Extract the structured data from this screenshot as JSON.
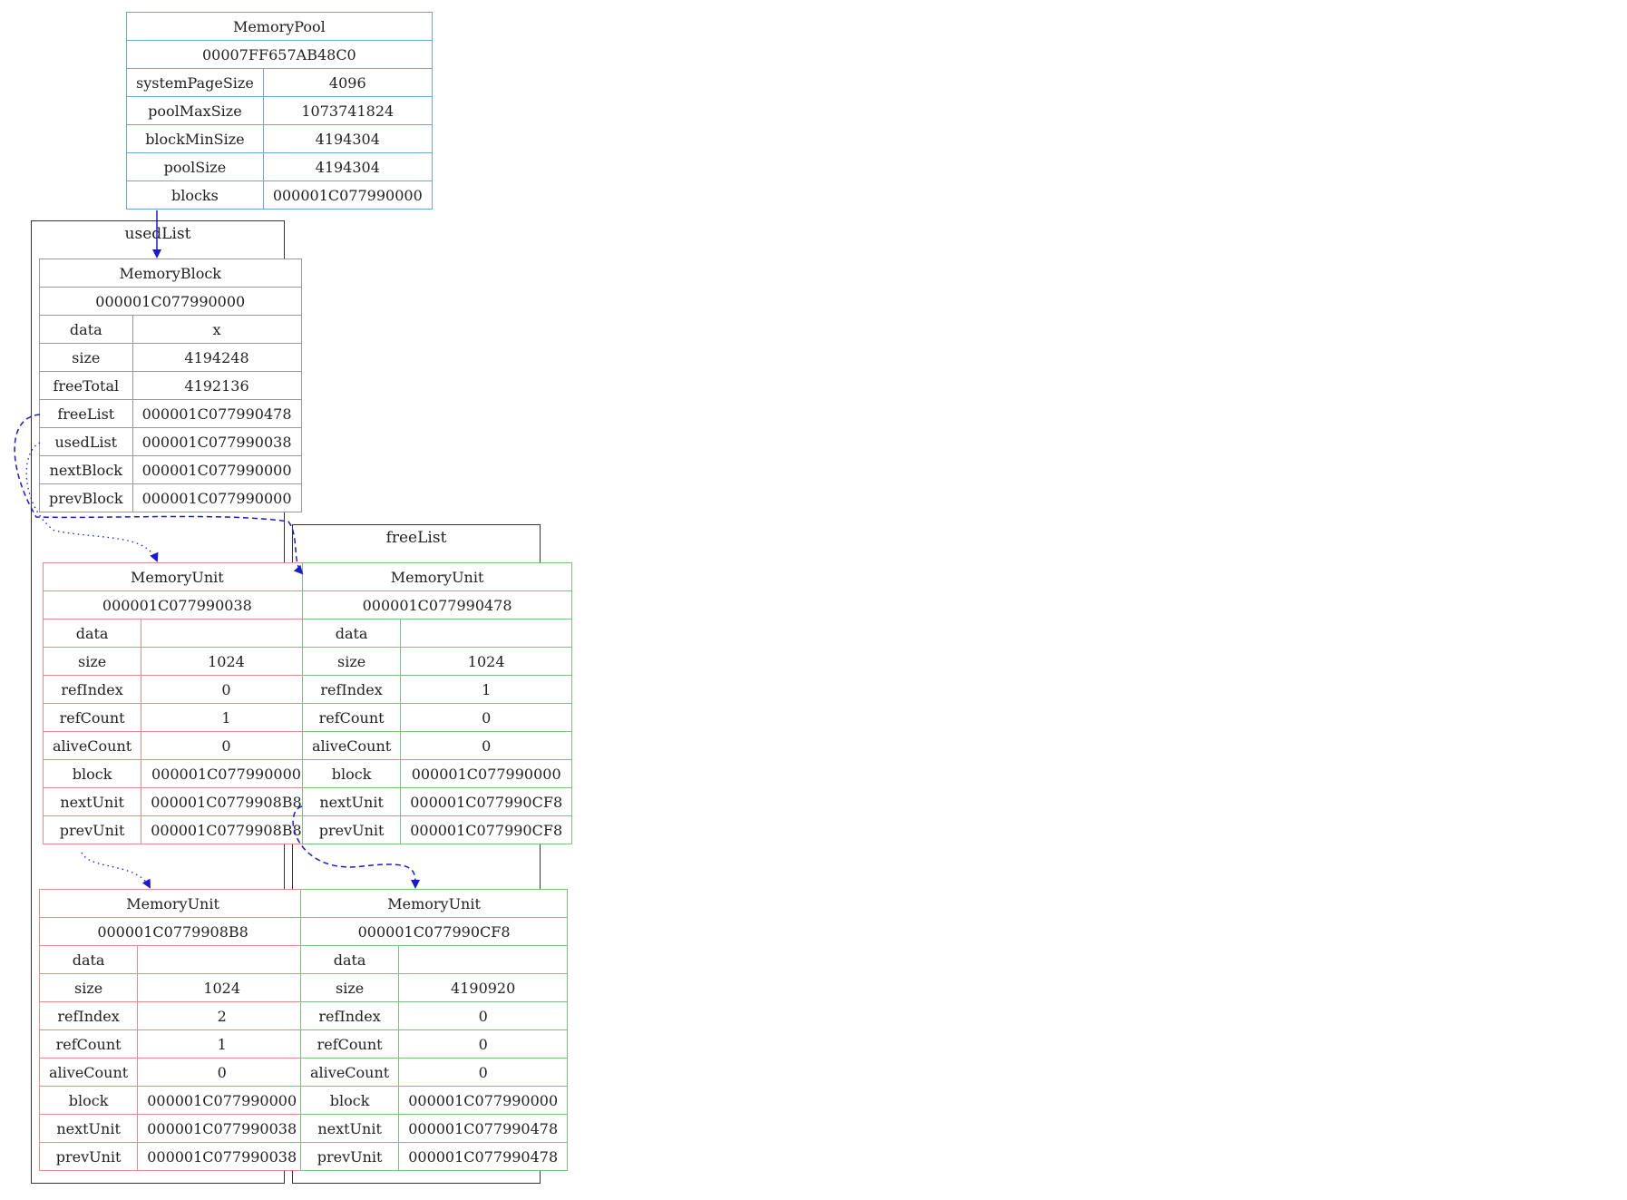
{
  "clusters": {
    "used": "usedList",
    "free": "freeList"
  },
  "pool": {
    "title": "MemoryPool",
    "address": "00007FF657AB48C0",
    "rows": [
      {
        "key": "systemPageSize",
        "val": "4096"
      },
      {
        "key": "poolMaxSize",
        "val": "1073741824"
      },
      {
        "key": "blockMinSize",
        "val": "4194304"
      },
      {
        "key": "poolSize",
        "val": "4194304"
      },
      {
        "key": "blocks",
        "val": "000001C077990000"
      }
    ]
  },
  "block": {
    "title": "MemoryBlock",
    "address": "000001C077990000",
    "rows": [
      {
        "key": "data",
        "val": "x"
      },
      {
        "key": "size",
        "val": "4194248"
      },
      {
        "key": "freeTotal",
        "val": "4192136"
      },
      {
        "key": "freeList",
        "val": "000001C077990478"
      },
      {
        "key": "usedList",
        "val": "000001C077990038"
      },
      {
        "key": "nextBlock",
        "val": "000001C077990000"
      },
      {
        "key": "prevBlock",
        "val": "000001C077990000"
      }
    ]
  },
  "units": [
    {
      "title": "MemoryUnit",
      "address": "000001C077990038",
      "rows": [
        {
          "key": "data",
          "val": ""
        },
        {
          "key": "size",
          "val": "1024"
        },
        {
          "key": "refIndex",
          "val": "0"
        },
        {
          "key": "refCount",
          "val": "1"
        },
        {
          "key": "aliveCount",
          "val": "0"
        },
        {
          "key": "block",
          "val": "000001C077990000"
        },
        {
          "key": "nextUnit",
          "val": "000001C0779908B8"
        },
        {
          "key": "prevUnit",
          "val": "000001C0779908B8"
        }
      ]
    },
    {
      "title": "MemoryUnit",
      "address": "000001C0779908B8",
      "rows": [
        {
          "key": "data",
          "val": ""
        },
        {
          "key": "size",
          "val": "1024"
        },
        {
          "key": "refIndex",
          "val": "2"
        },
        {
          "key": "refCount",
          "val": "1"
        },
        {
          "key": "aliveCount",
          "val": "0"
        },
        {
          "key": "block",
          "val": "000001C077990000"
        },
        {
          "key": "nextUnit",
          "val": "000001C077990038"
        },
        {
          "key": "prevUnit",
          "val": "000001C077990038"
        }
      ]
    },
    {
      "title": "MemoryUnit",
      "address": "000001C077990478",
      "rows": [
        {
          "key": "data",
          "val": ""
        },
        {
          "key": "size",
          "val": "1024"
        },
        {
          "key": "refIndex",
          "val": "1"
        },
        {
          "key": "refCount",
          "val": "0"
        },
        {
          "key": "aliveCount",
          "val": "0"
        },
        {
          "key": "block",
          "val": "000001C077990000"
        },
        {
          "key": "nextUnit",
          "val": "000001C077990CF8"
        },
        {
          "key": "prevUnit",
          "val": "000001C077990CF8"
        }
      ]
    },
    {
      "title": "MemoryUnit",
      "address": "000001C077990CF8",
      "rows": [
        {
          "key": "data",
          "val": ""
        },
        {
          "key": "size",
          "val": "4190920"
        },
        {
          "key": "refIndex",
          "val": "0"
        },
        {
          "key": "refCount",
          "val": "0"
        },
        {
          "key": "aliveCount",
          "val": "0"
        },
        {
          "key": "block",
          "val": "000001C077990000"
        },
        {
          "key": "nextUnit",
          "val": "000001C077990478"
        },
        {
          "key": "prevUnit",
          "val": "000001C077990478"
        }
      ]
    }
  ],
  "colors": {
    "pool": "#6aa6e0",
    "block": "#999999",
    "used": "#e88a8a",
    "free": "#7cc27c",
    "edge": "#1a1ad6"
  }
}
